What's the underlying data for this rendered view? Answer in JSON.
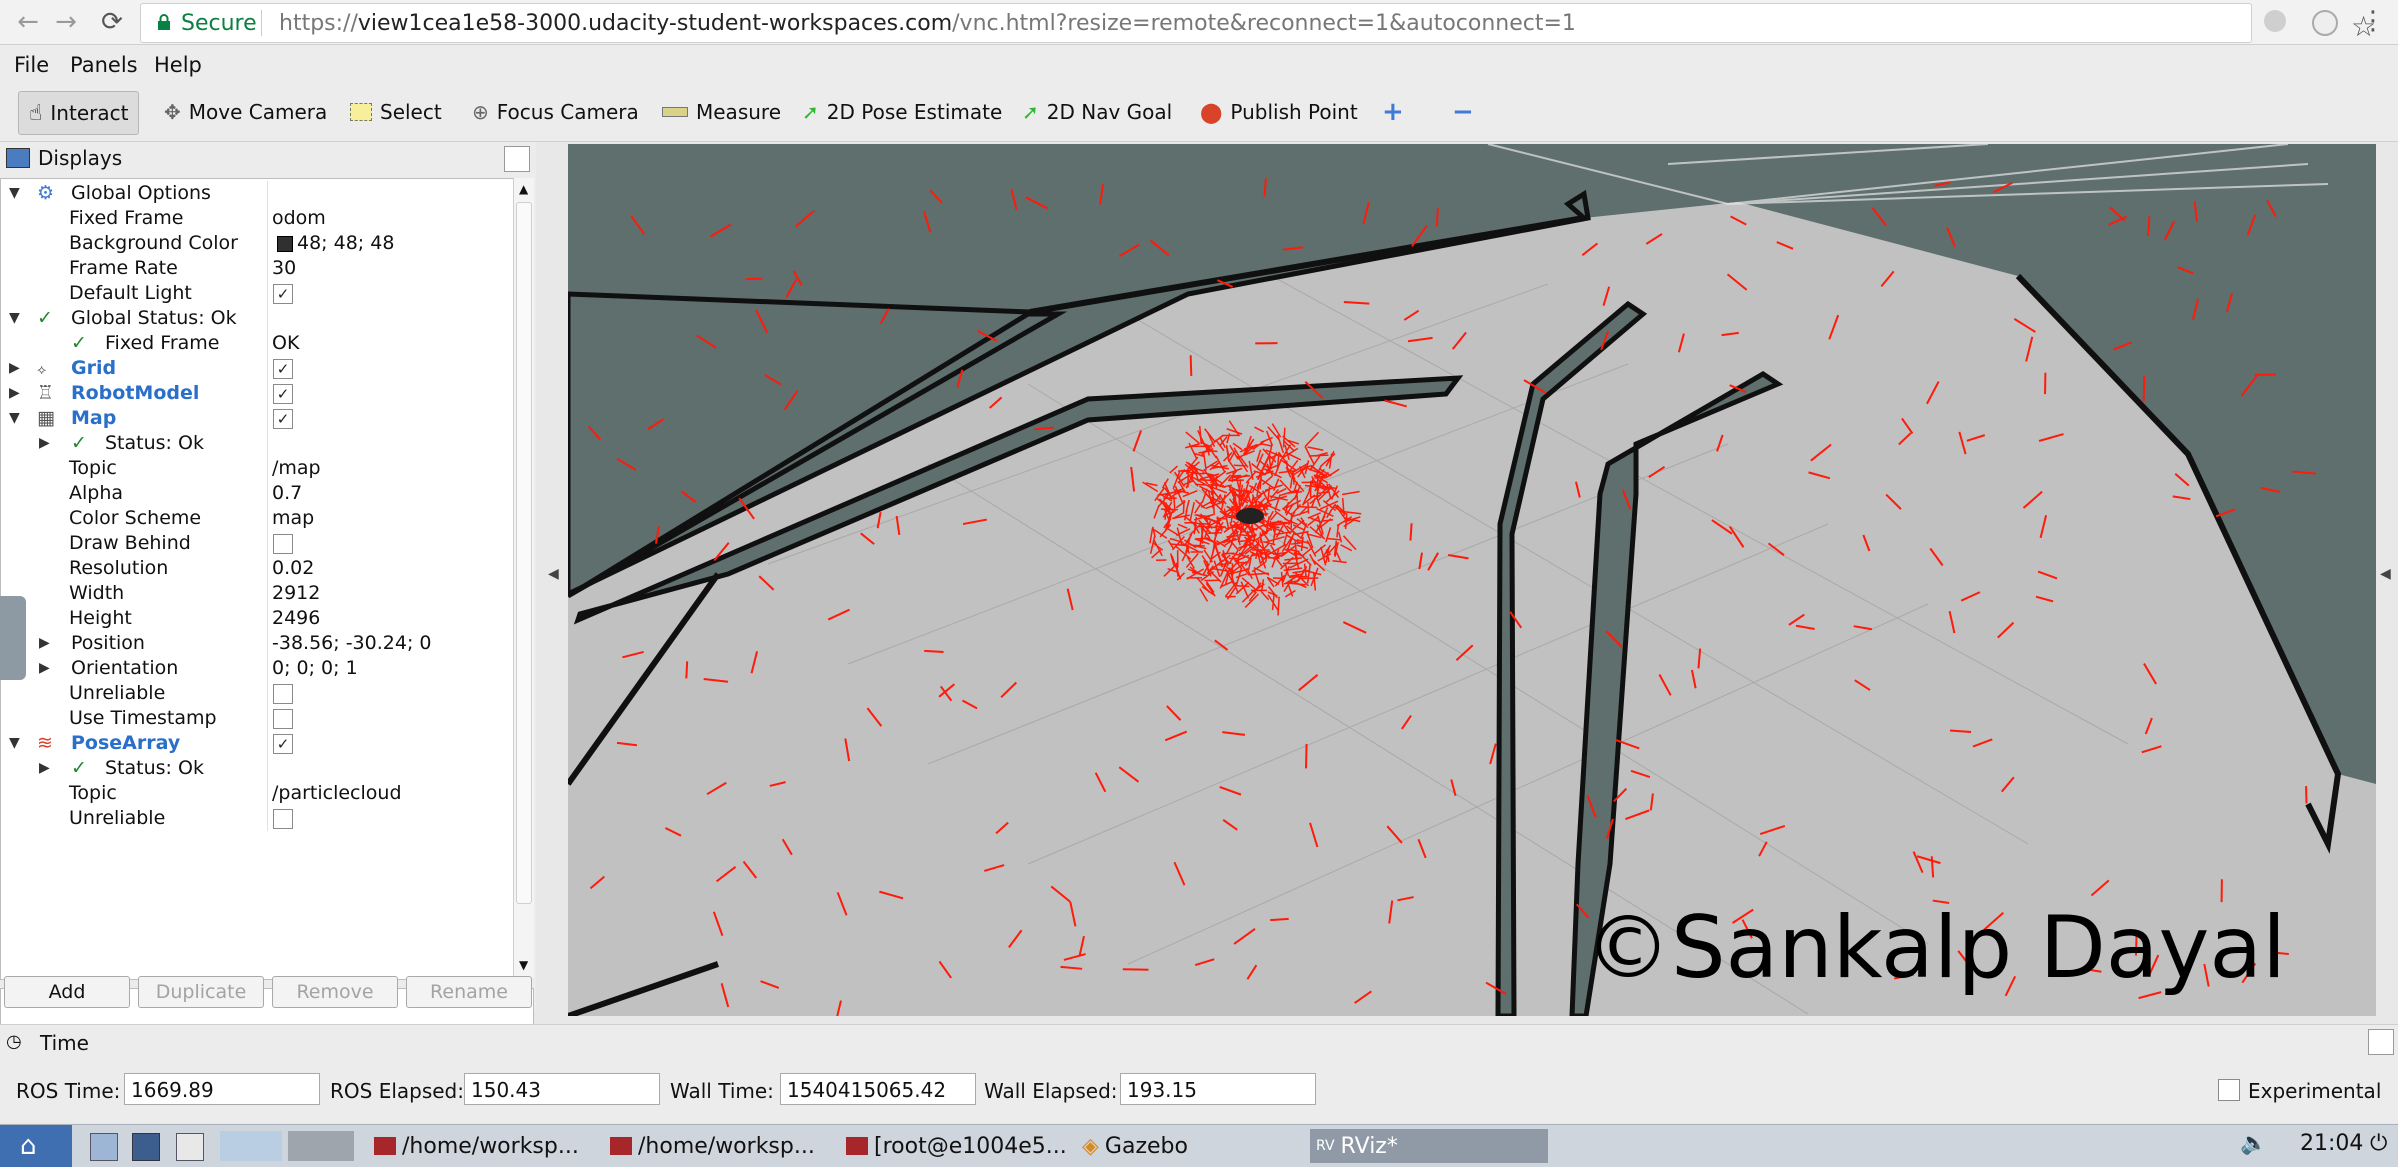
{
  "browser": {
    "secure_label": "Secure",
    "url_scheme": "https://",
    "url_host": "view1cea1e58-3000.udacity-student-workspaces.com",
    "url_path": "/vnc.html?resize=remote&reconnect=1&autoconnect=1"
  },
  "menu": [
    "File",
    "Panels",
    "Help"
  ],
  "toolbar": {
    "interact": "Interact",
    "move_camera": "Move Camera",
    "select": "Select",
    "focus_camera": "Focus Camera",
    "measure": "Measure",
    "pose_estimate": "2D Pose Estimate",
    "nav_goal": "2D Nav Goal",
    "publish_point": "Publish Point"
  },
  "displays": {
    "title": "Displays",
    "rows": [
      {
        "label": "Global Options",
        "value": ""
      },
      {
        "label": "Fixed Frame",
        "value": "odom"
      },
      {
        "label": "Background Color",
        "value": "48; 48; 48"
      },
      {
        "label": "Frame Rate",
        "value": "30"
      },
      {
        "label": "Default Light",
        "value": ""
      },
      {
        "label": "Global Status: Ok",
        "value": ""
      },
      {
        "label": "Fixed Frame",
        "value": "OK"
      },
      {
        "label": "Grid",
        "value": ""
      },
      {
        "label": "RobotModel",
        "value": ""
      },
      {
        "label": "Map",
        "value": ""
      },
      {
        "label": "Status: Ok",
        "value": ""
      },
      {
        "label": "Topic",
        "value": "/map"
      },
      {
        "label": "Alpha",
        "value": "0.7"
      },
      {
        "label": "Color Scheme",
        "value": "map"
      },
      {
        "label": "Draw Behind",
        "value": ""
      },
      {
        "label": "Resolution",
        "value": "0.02"
      },
      {
        "label": "Width",
        "value": "2912"
      },
      {
        "label": "Height",
        "value": "2496"
      },
      {
        "label": "Position",
        "value": "-38.56; -30.24; 0"
      },
      {
        "label": "Orientation",
        "value": "0; 0; 0; 1"
      },
      {
        "label": "Unreliable",
        "value": ""
      },
      {
        "label": "Use Timestamp",
        "value": ""
      },
      {
        "label": "PoseArray",
        "value": ""
      },
      {
        "label": "Status: Ok",
        "value": ""
      },
      {
        "label": "Topic",
        "value": "/particlecloud"
      },
      {
        "label": "Unreliable",
        "value": ""
      }
    ],
    "checkboxes": {
      "default_light": true,
      "grid": true,
      "robotmodel": true,
      "map": true,
      "draw_behind": false,
      "unreliable": false,
      "use_timestamp": false,
      "posearray": true,
      "pa_unreliable": false
    },
    "buttons": {
      "add": "Add",
      "duplicate": "Duplicate",
      "remove": "Remove",
      "rename": "Rename"
    }
  },
  "viewport": {
    "watermark": "©Sankalp Dayal",
    "colors": {
      "background": "#5e6f6e",
      "free_space": "#c1c1c1",
      "walls": "#101010",
      "particles": "#ff1a0a"
    }
  },
  "time": {
    "title": "Time",
    "ros_time_label": "ROS Time:",
    "ros_time": "1669.89",
    "ros_elapsed_label": "ROS Elapsed:",
    "ros_elapsed": "150.43",
    "wall_time_label": "Wall Time:",
    "wall_time": "1540415065.42",
    "wall_elapsed_label": "Wall Elapsed:",
    "wall_elapsed": "193.15",
    "experimental": "Experimental"
  },
  "taskbar": {
    "tasks": [
      "/home/worksp...",
      "/home/worksp...",
      "[root@e1004e5...",
      "Gazebo",
      "RViz*"
    ],
    "rviz_prefix": "RV",
    "clock": "21:04"
  }
}
